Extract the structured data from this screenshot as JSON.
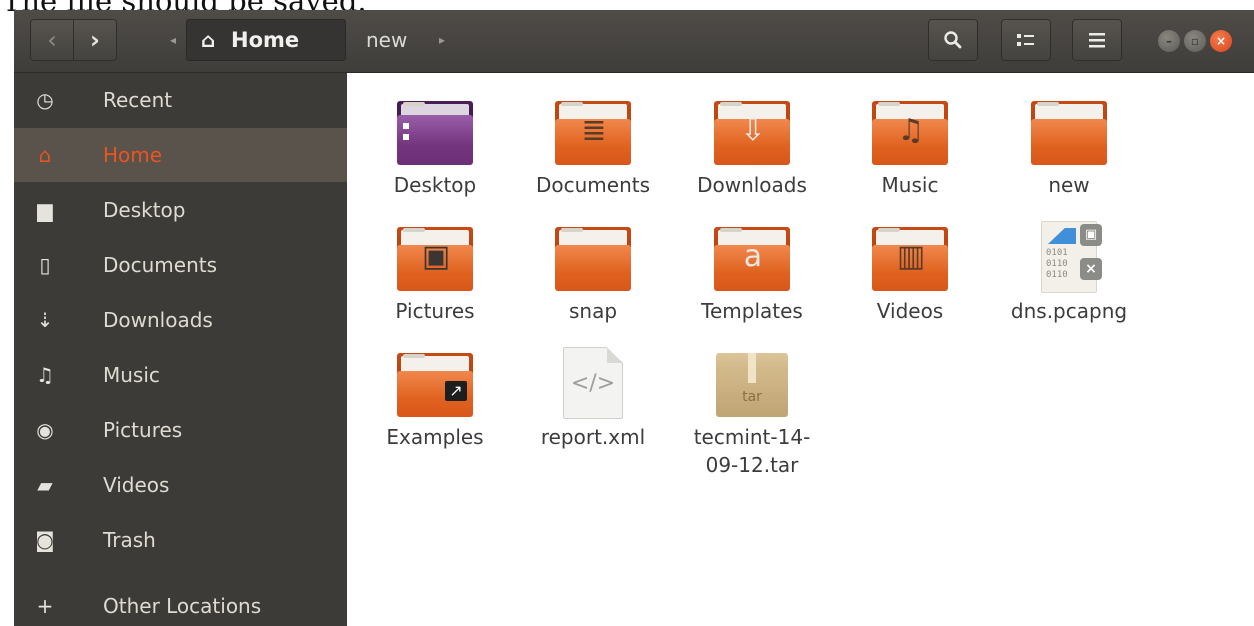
{
  "caption": "The file should be saved.",
  "header": {
    "back_glyph": "‹",
    "forward_glyph": "›",
    "path_left_arrow": "◂",
    "path_right_arrow": "▸",
    "crumbs": [
      {
        "label": "Home",
        "icon": "home-icon"
      },
      {
        "label": "new"
      }
    ],
    "search_glyph": "🔍",
    "view_glyph": "☷",
    "menu_glyph": "☰",
    "window_buttons": [
      "minimize",
      "maximize",
      "close"
    ]
  },
  "sidebar": {
    "items": [
      {
        "label": "Recent",
        "icon": "clock-icon",
        "glyph": "◷"
      },
      {
        "label": "Home",
        "icon": "home-icon",
        "glyph": "⌂",
        "active": true
      },
      {
        "label": "Desktop",
        "icon": "folder-icon",
        "glyph": "▆"
      },
      {
        "label": "Documents",
        "icon": "document-icon",
        "glyph": "▯"
      },
      {
        "label": "Downloads",
        "icon": "download-icon",
        "glyph": "⇣"
      },
      {
        "label": "Music",
        "icon": "music-icon",
        "glyph": "♫"
      },
      {
        "label": "Pictures",
        "icon": "camera-icon",
        "glyph": "◉"
      },
      {
        "label": "Videos",
        "icon": "video-icon",
        "glyph": "▰"
      },
      {
        "label": "Trash",
        "icon": "trash-icon",
        "glyph": "◙"
      },
      {
        "label": "Other Locations",
        "icon": "plus-icon",
        "glyph": "+"
      }
    ]
  },
  "files": [
    {
      "name": "Desktop",
      "type": "folder-desktop"
    },
    {
      "name": "Documents",
      "type": "folder",
      "emblem": "≣"
    },
    {
      "name": "Downloads",
      "type": "folder",
      "emblem": "⇩"
    },
    {
      "name": "Music",
      "type": "folder",
      "emblem": "♫"
    },
    {
      "name": "new",
      "type": "folder",
      "emblem": ""
    },
    {
      "name": "Pictures",
      "type": "folder",
      "emblem": "▣"
    },
    {
      "name": "snap",
      "type": "folder",
      "emblem": ""
    },
    {
      "name": "Templates",
      "type": "folder",
      "emblem": "a"
    },
    {
      "name": "Videos",
      "type": "folder",
      "emblem": "▥"
    },
    {
      "name": "dns.pcapng",
      "type": "pcap"
    },
    {
      "name": "Examples",
      "type": "folder",
      "emblem": "↗"
    },
    {
      "name": "report.xml",
      "type": "xml",
      "emblem": "</>"
    },
    {
      "name": "tecmint-14-\n09-12.tar",
      "name_line1": "tecmint-14-",
      "name_line2": "09-12.tar",
      "type": "tar",
      "emblem": "tar"
    }
  ],
  "pcap_bits": [
    "0101",
    "0110",
    "0110"
  ],
  "colors": {
    "accent": "#e95420",
    "sidebar_bg": "#3c3b37",
    "header_bg": "#45433f",
    "folder_orange": "#e0621f"
  }
}
